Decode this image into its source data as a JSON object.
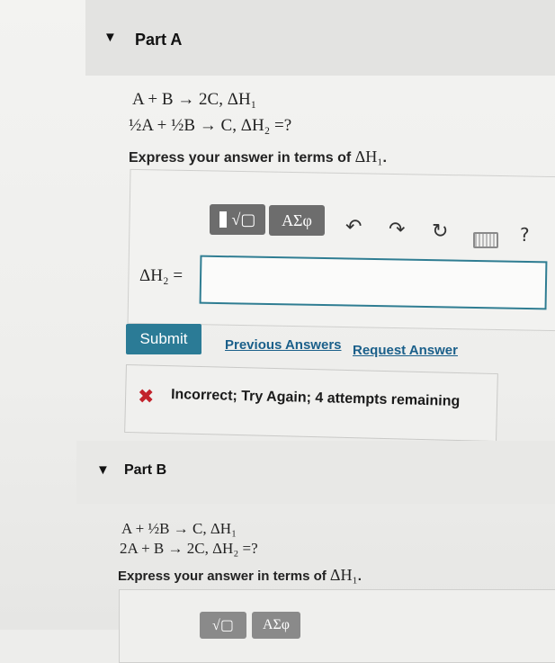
{
  "part_a": {
    "title": "Part A",
    "equation1": "A + B → 2C,  ΔH₁",
    "equation2": "½A + ½B → C,  ΔH₂ =?",
    "instruction_prefix": "Express your answer in terms of ",
    "instruction_math": "ΔH₁",
    "instruction_suffix": ".",
    "toolbar": {
      "templates_label": "√▢",
      "greek_label": "ΑΣφ",
      "undo_icon": "↶",
      "redo_icon": "↷",
      "reset_icon": "↻",
      "help_label": "?"
    },
    "answer_label": "ΔH₂ =",
    "answer_value": "",
    "submit_label": "Submit",
    "previous_answers_label": "Previous Answers",
    "request_answer_label": "Request Answer",
    "feedback_text": "Incorrect; Try Again; 4 attempts remaining"
  },
  "part_b": {
    "title": "Part B",
    "equation1": "A + ½B → C,  ΔH₁",
    "equation2": "2A + B → 2C,  ΔH₂ =?",
    "instruction_prefix": "Express your answer in terms of ",
    "instruction_math": "ΔH₁",
    "instruction_suffix": ".",
    "toolbar": {
      "templates_label": "√▢",
      "greek_label": "ΑΣφ"
    }
  },
  "colors": {
    "accent": "#2b7b96",
    "error": "#c2222b",
    "link": "#1a5f8a"
  }
}
